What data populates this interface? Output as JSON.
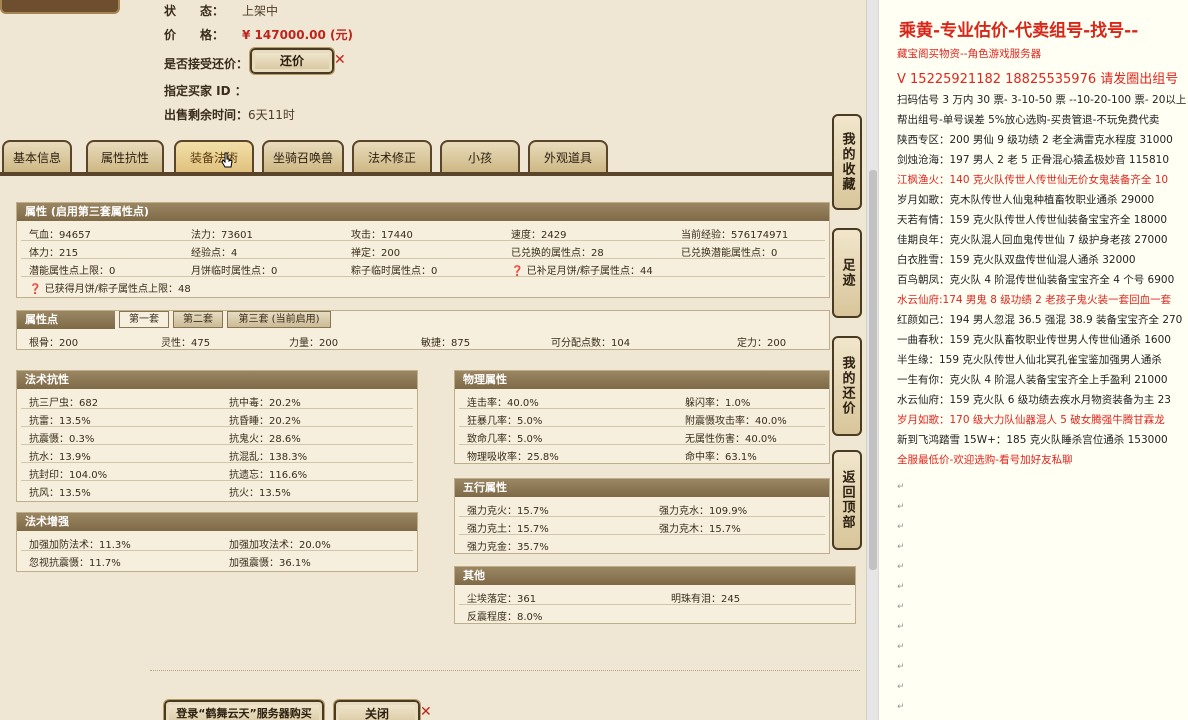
{
  "item": {
    "status_label": "状　　态：",
    "status_value": "上架中",
    "price_label": "价　　格：",
    "price_value": "¥ 147000.00 (元)",
    "counter_label": "是否接受还价：",
    "counter_button": "还价",
    "buyer_label": "指定买家 ID ：",
    "remain_label": "出售剩余时间：",
    "remain_value": "6天11时"
  },
  "tabs": [
    "基本信息",
    "属性抗性",
    "装备法術",
    "坐骑召唤兽",
    "法术修正",
    "小孩",
    "外观道具"
  ],
  "attr_panel": {
    "title": "属性 (启用第三套属性点)",
    "rows": [
      [
        "气血：94657",
        "法力：73601",
        "攻击：17440",
        "速度：2429",
        "当前经验：576174971"
      ],
      [
        "体力：215",
        "经验点：4",
        "禅定：200",
        "已兑换的属性点：28",
        "已兑换潜能属性点：0"
      ],
      [
        "潜能属性点上限：0",
        "月饼临时属性点：0",
        "粽子临时属性点：0",
        "已补足月饼/粽子属性点：44",
        ""
      ],
      [
        "已获得月饼/粽子属性点上限：48",
        "",
        "",
        "",
        ""
      ]
    ]
  },
  "points_panel": {
    "title": "属性点",
    "subtabs": [
      "第一套",
      "第二套",
      "第三套 (当前启用)"
    ],
    "values": [
      "根骨：200",
      "灵性：475",
      "力量：200",
      "敏捷：875",
      "可分配点数：104",
      "定力：200"
    ]
  },
  "resist_panel": {
    "title": "法术抗性",
    "rows": [
      [
        "抗三尸虫：682",
        "抗中毒：20.2%"
      ],
      [
        "抗雷：13.5%",
        "抗昏睡：20.2%"
      ],
      [
        "抗震慑：0.3%",
        "抗鬼火：28.6%"
      ],
      [
        "抗水：13.9%",
        "抗混乱：138.3%"
      ],
      [
        "抗封印：104.0%",
        "抗遗忘：116.6%"
      ],
      [
        "抗风：13.5%",
        "抗火：13.5%"
      ]
    ]
  },
  "enhance_panel": {
    "title": "法术增强",
    "rows": [
      [
        "加强加防法术：11.3%",
        "加强加攻法术：20.0%"
      ],
      [
        "忽视抗震慑：11.7%",
        "加强震慑：36.1%"
      ]
    ]
  },
  "physical_panel": {
    "title": "物理属性",
    "rows": [
      [
        "连击率：40.0%",
        "躲闪率：1.0%"
      ],
      [
        "狂暴几率：5.0%",
        "附震慑攻击率：40.0%"
      ],
      [
        "致命几率：5.0%",
        "无属性伤害：40.0%"
      ],
      [
        "物理吸收率：25.8%",
        "命中率：63.1%"
      ]
    ]
  },
  "elements_panel": {
    "title": "五行属性",
    "rows": [
      [
        "强力克火：15.7%",
        "强力克水：109.9%"
      ],
      [
        "强力克土：15.7%",
        "强力克木：15.7%"
      ],
      [
        "强力克金：35.7%",
        ""
      ]
    ]
  },
  "other_panel": {
    "title": "其他",
    "rows": [
      [
        "尘埃落定：361",
        "明珠有泪：245"
      ],
      [
        "反震程度：8.0%",
        ""
      ]
    ]
  },
  "side_buttons": [
    "我的收藏",
    "足迹",
    "我的还价",
    "返回顶部"
  ],
  "bottom": {
    "login_button": "登录“鹤舞云天”服务器购买",
    "close_button": "关闭"
  },
  "doc": {
    "title": "乘黄-专业估价-代卖组号-找号--",
    "lines": [
      {
        "text": "藏宝阁买物资--角色游戏服务器",
        "red": true
      },
      {
        "text": "V 15225921182    18825535976  请发圈出组号",
        "red": true,
        "big": true
      },
      {
        "text": "扫码估号 3 万内 30 票- 3-10-50 票  --10-20-100 票- 20以上",
        "red": false
      },
      {
        "text": "帮出组号-单号误差 5%放心选购-买贵管退-不玩免费代卖",
        "red": false
      },
      {
        "text": "陕西专区：200 男仙 9 级功绩 2 老全满雷克水程度 31000",
        "red": false
      },
      {
        "text": "剑烛沧海：197 男人 2 老 5 正骨混心猿孟极妙音 115810",
        "red": false
      },
      {
        "text": "江枫渔火：140 克火队传世人传世仙无价女鬼装备齐全 10",
        "red": true
      },
      {
        "text": "岁月如歌：克木队传世人仙鬼种植畜牧职业通杀 29000",
        "red": false
      },
      {
        "text": "天若有情：159 克火队传世人传世仙装备宝宝齐全 18000",
        "red": false
      },
      {
        "text": "佳期良年：克火队混人回血鬼传世仙 7 级护身老孩 27000",
        "red": false
      },
      {
        "text": "白衣胜雪：159 克火队双盘传世仙混人通杀 32000",
        "red": false
      },
      {
        "text": "百鸟朝凤：克火队 4 阶混传世仙装备宝宝齐全 4 个号 6900",
        "red": false
      },
      {
        "text": "水云仙府:174 男鬼 8 级功绩 2 老孩子鬼火装一套回血一套",
        "red": true
      },
      {
        "text": "红颜如己：194 男人忽混 36.5 强混 38.9 装备宝宝齐全 270",
        "red": false
      },
      {
        "text": "一曲春秋：159 克火队畜牧职业传世男人传世仙通杀 1600",
        "red": false
      },
      {
        "text": "半生缘：159 克火队传世人仙北冥孔雀宝鉴加强男人通杀",
        "red": false
      },
      {
        "text": "一生有你：克火队 4 阶混人装备宝宝齐全上手盈利 21000",
        "red": false
      },
      {
        "text": "水云仙府：159 克火队 6 级功绩去疾水月物资装备为主 23",
        "red": false
      },
      {
        "text": "岁月如歌：170 级大力队仙器混人 5 破女腾强牛腾甘霖龙",
        "red": true
      },
      {
        "text": "新到飞鸿踏雪 15W+：185 克火队睡杀宫位通杀 153000",
        "red": false
      },
      {
        "text": "全服最低价-欢迎选购-看号加好友私聊",
        "red": true
      }
    ]
  }
}
